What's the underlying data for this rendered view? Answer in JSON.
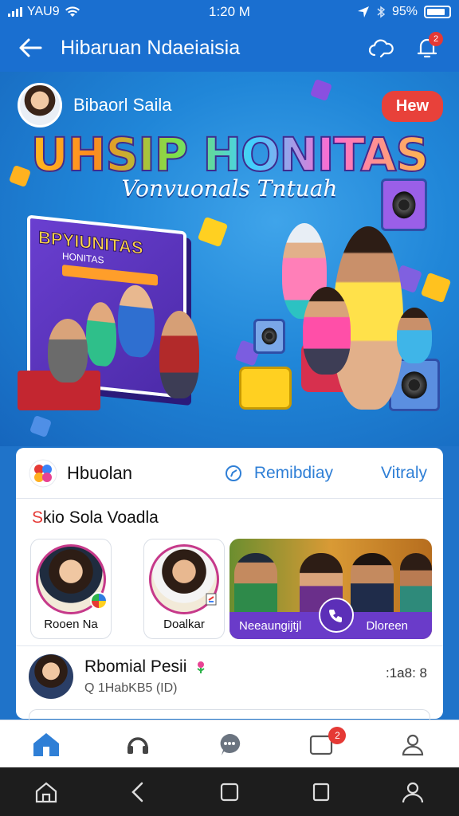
{
  "status_bar": {
    "carrier": "YAU9",
    "time": "1:20 M",
    "battery": "95%"
  },
  "header": {
    "title": "Hibaruan Ndaeiaisia",
    "notification_count": "2"
  },
  "banner": {
    "user_name": "Bibaorl Saila",
    "new_badge": "Hew",
    "headline": "UHSIP HONITAS",
    "subline": "Vonvuonals Tntuah",
    "box_title": "BPYIUNITAS",
    "box_subtitle": "HONITAS"
  },
  "card": {
    "tab_main": "Hbuolan",
    "tab_secondary": "Remibdiay",
    "tab_third": "Vitraly",
    "section_title_first": "S",
    "section_title_rest": "kio Sola Voadla",
    "contacts": [
      {
        "name": "Rooen Na"
      },
      {
        "name": "Doalkar"
      }
    ],
    "group_left": "Neeaungijtjl",
    "group_right": "Dloreen",
    "post": {
      "name": "Rbomial Pesii",
      "sub": "Q 1HabKB5 (ID)",
      "time": ":1a8: 8"
    }
  },
  "bottom_nav": {
    "badge": "2"
  },
  "colors": {
    "primary": "#1a6fd0",
    "accent_red": "#e53935",
    "link_blue": "#2f7fd6",
    "purple": "#6a3bc9"
  },
  "icons": [
    "back-arrow-icon",
    "cloud-icon",
    "bell-icon",
    "home-icon",
    "headset-icon",
    "chat-icon",
    "inbox-icon",
    "profile-icon"
  ]
}
